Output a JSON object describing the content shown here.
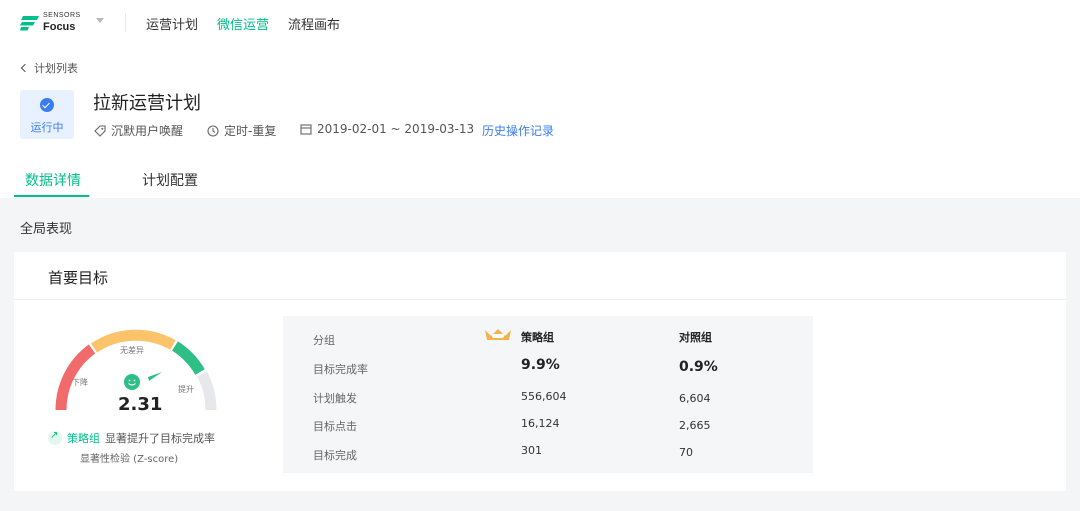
{
  "nav": {
    "logo_line1": "SENSORS",
    "logo_line2": "Focus",
    "items": [
      {
        "label": "运营计划"
      },
      {
        "label": "微信运营"
      },
      {
        "label": "流程画布"
      }
    ]
  },
  "header": {
    "back_label": "计划列表",
    "status": "运行中",
    "title": "拉新运营计划",
    "tag": "沉默用户唤醒",
    "schedule": "定时-重复",
    "date_range": "2019-02-01 ~ 2019-03-13",
    "history_link": "历史操作记录"
  },
  "tabs": [
    {
      "label": "数据详情"
    },
    {
      "label": "计划配置"
    }
  ],
  "section_title": "全局表现",
  "card": {
    "title": "首要目标",
    "gauge": {
      "value": "2.31",
      "label_down": "下降",
      "label_nodiff": "无差异",
      "label_up": "提升"
    },
    "result": {
      "strategy": "策略组",
      "text": "显著提升了目标完成率"
    },
    "test": "显著性检验 (Z-score)",
    "table": {
      "header_label": "分组",
      "strategy_head": "策略组",
      "control_head": "对照组",
      "rows": [
        {
          "label": "目标完成率",
          "strategy": "9.9%",
          "control": "0.9%"
        },
        {
          "label": "计划触发",
          "strategy": "556,604",
          "control": "6,604"
        },
        {
          "label": "目标点击",
          "strategy": "16,124",
          "control": "2,665"
        },
        {
          "label": "目标完成",
          "strategy": "301",
          "control": "70"
        }
      ]
    }
  },
  "colors": {
    "brand_green": "#00bf8a",
    "link_blue": "#3a7df0",
    "gauge_red": "#f26b6b",
    "gauge_yellow": "#fbc46a",
    "gauge_green": "#2dbf86",
    "gauge_grey": "#e6e8eb"
  }
}
